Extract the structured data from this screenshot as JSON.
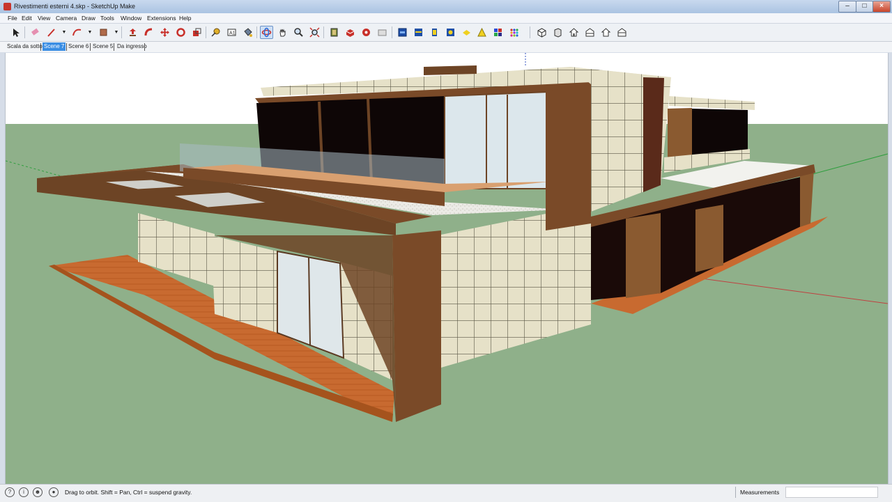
{
  "window": {
    "title": "Rivestimenti esterni 4.skp - SketchUp Make"
  },
  "menu": [
    "File",
    "Edit",
    "View",
    "Camera",
    "Draw",
    "Tools",
    "Window",
    "Extensions",
    "Help"
  ],
  "toolbar": {
    "tools": [
      "select-tool",
      "eraser-tool",
      "line-tool",
      "arc-tool",
      "rectangle-tool",
      "push-pull-tool",
      "follow-me-tool",
      "move-tool",
      "rotate-tool",
      "scale-tool",
      "tape-measure-tool",
      "text-tool",
      "paint-bucket-tool",
      "orbit-tool",
      "pan-tool",
      "zoom-tool",
      "zoom-extents-tool",
      "components-tool",
      "3d-warehouse-tool",
      "extension-warehouse-tool",
      "section-plane-tool",
      "layers-tool",
      "styles-tool",
      "shadows-tool",
      "fog-tool",
      "axes-tool",
      "materials-tool",
      "scenes-tool",
      "iso-view",
      "top-view",
      "front-view",
      "right-view",
      "back-view",
      "left-view"
    ],
    "active_tool": "orbit-tool"
  },
  "scenes": [
    {
      "label": "Scala da sotto",
      "active": false
    },
    {
      "label": "Scene 7",
      "active": true
    },
    {
      "label": "Scene 6",
      "active": false
    },
    {
      "label": "Scene 5",
      "active": false
    },
    {
      "label": "Da ingresso",
      "active": false
    }
  ],
  "status": {
    "hint": "Drag to orbit. Shift = Pan, Ctrl = suspend gravity.",
    "measurements_label": "Measurements",
    "measurements_value": ""
  },
  "colors": {
    "sky": "#ffffff",
    "ground": "#8fb08a",
    "accent": "#3b8ee4",
    "wood": "#7a4a28",
    "tile": "#e8e4cf",
    "deck": "#c8672c"
  }
}
